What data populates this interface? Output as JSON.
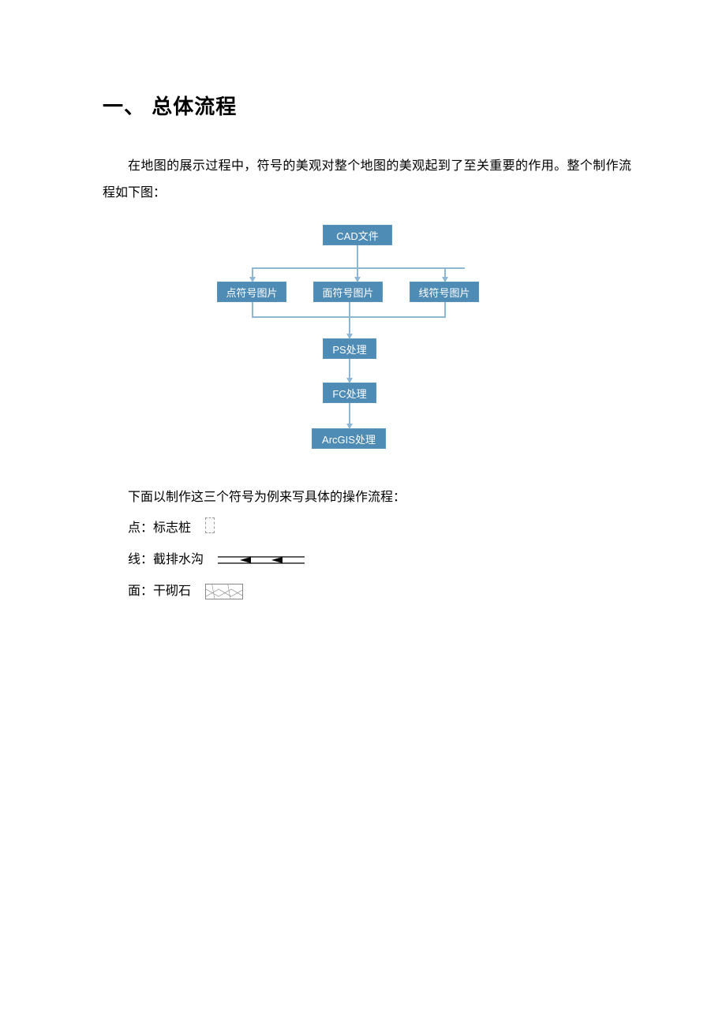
{
  "heading": "一、 总体流程",
  "paragraph": "在地图的展示过程中，符号的美观对整个地图的美观起到了至关重要的作用。整个制作流程如下图：",
  "flow": {
    "top": "CAD文件",
    "left": "点符号图片",
    "mid": "面符号图片",
    "right": "线符号图片",
    "ps": "PS处理",
    "fc": "FC处理",
    "arc": "ArcGIS处理"
  },
  "subtext": "下面以制作这三个符号为例来写具体的操作流程：",
  "examples": {
    "point": "点：标志桩",
    "line": "线：截排水沟",
    "area": "面：干砌石"
  }
}
